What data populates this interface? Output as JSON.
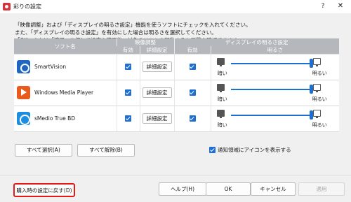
{
  "window": {
    "title": "彩りの設定",
    "help_glyph": "?",
    "close_glyph": "✕"
  },
  "instructions": [
    "「映像調整」および「ディスプレイの明るさ設定」機能を使うソフトにチェックを入れてください。",
    "また、「ディスプレイの明るさ設定」を有効にした場合は明るさを選択してください。",
    "「OK」または「適用」を押して設定を適用後、対象のソフトを起動すると画質を確認できます。"
  ],
  "table": {
    "header": {
      "software": "ソフト名",
      "video": "映像調整",
      "display": "ディスプレイの明るさ設定",
      "enabled": "有効",
      "details": "詳細設定",
      "brightness": "明るさ"
    },
    "rows": [
      {
        "name": "SmartVision",
        "icon": "smartvision-icon",
        "video_enabled": true,
        "details_label": "詳細設定",
        "display_enabled": true,
        "brightness_level": 1.0,
        "dark_label": "暗い",
        "bright_label": "明るい"
      },
      {
        "name": "Windows Media Player",
        "icon": "windows-media-player-icon",
        "video_enabled": true,
        "details_label": "詳細設定",
        "display_enabled": true,
        "brightness_level": 1.0,
        "dark_label": "暗い",
        "bright_label": "明るい"
      },
      {
        "name": "sMedio True BD",
        "icon": "smedio-true-bd-icon",
        "video_enabled": true,
        "details_label": "詳細設定",
        "display_enabled": true,
        "brightness_level": 1.0,
        "dark_label": "暗い",
        "bright_label": "明るい"
      }
    ]
  },
  "buttons": {
    "select_all": "すべて選択(A)",
    "deselect_all": "すべて解除(B)",
    "reset": "購入時の設定に戻す(D)",
    "help": "ヘルプ(H)",
    "ok": "OK",
    "cancel": "キャンセル",
    "apply": "適用"
  },
  "tray_option": {
    "label": "通知領域にアイコンを表示する",
    "checked": true
  },
  "colors": {
    "accent": "#1e6fd0",
    "header": "#b4b8bc",
    "reset_highlight": "#e81818"
  }
}
